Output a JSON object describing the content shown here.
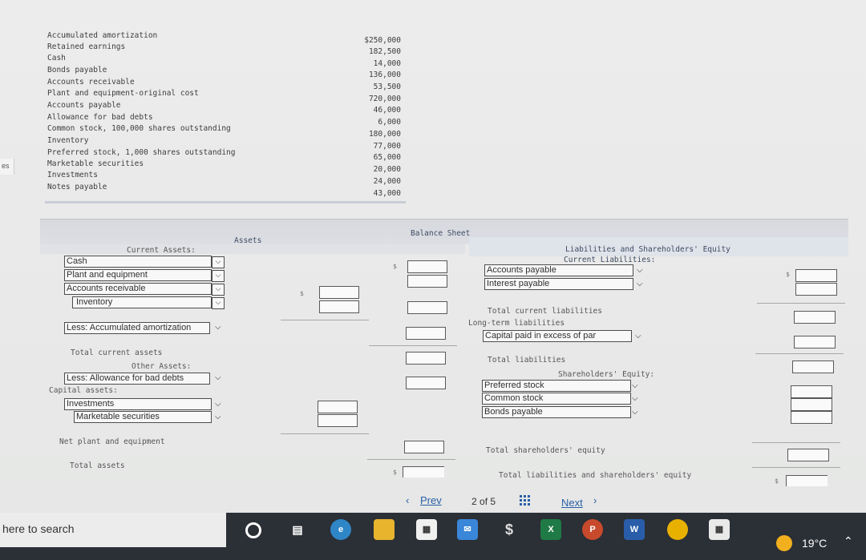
{
  "sidebar": {
    "tab_label": "es"
  },
  "data_list": [
    {
      "label": "Accumulated amortization",
      "value": "$250,000"
    },
    {
      "label": "Retained earnings",
      "value": "182,500"
    },
    {
      "label": "Cash",
      "value": "14,000"
    },
    {
      "label": "Bonds payable",
      "value": "136,000"
    },
    {
      "label": "Accounts receivable",
      "value": "53,500"
    },
    {
      "label": "Plant and equipment-original cost",
      "value": "720,000"
    },
    {
      "label": "Accounts payable",
      "value": "46,000"
    },
    {
      "label": "Allowance for bad debts",
      "value": "6,000"
    },
    {
      "label": "Common stock, 100,000 shares outstanding",
      "value": "180,000"
    },
    {
      "label": "Inventory",
      "value": "77,000"
    },
    {
      "label": "Preferred stock, 1,000 shares outstanding",
      "value": "65,000"
    },
    {
      "label": "Marketable securities",
      "value": "20,000"
    },
    {
      "label": "Investments",
      "value": "24,000"
    },
    {
      "label": "Notes payable",
      "value": "43,000"
    }
  ],
  "balance_sheet": {
    "title": "Balance Sheet",
    "assets_heading": "Assets",
    "current_assets_label": "Current Assets:",
    "liab_heading": "Liabilities and Shareholders' Equity",
    "current_liab_label": "Current Liabilities:",
    "asset_selects": [
      "Cash",
      "Plant and equipment",
      "Accounts receivable",
      "Inventory"
    ],
    "less_accum": "Less: Accumulated amortization",
    "total_current_assets": "Total current assets",
    "other_assets": "Other Assets:",
    "less_allowance": "Less: Allowance for bad debts",
    "capital_assets": "Capital assets:",
    "capital_selects": [
      "Investments",
      "Marketable securities"
    ],
    "net_plant": "Net plant and equipment",
    "total_assets": "Total assets",
    "liab_selects": [
      "Accounts payable",
      "Interest payable"
    ],
    "total_current_liab": "Total current liabilities",
    "long_term_liab": "Long-term liabilities",
    "capital_paid": "Capital paid in excess of par",
    "total_liab": "Total liabilities",
    "shareholders_equity": "Shareholders' Equity:",
    "equity_selects": [
      "Preferred stock",
      "Common stock",
      "Bonds payable"
    ],
    "total_sh_equity": "Total shareholders' equity",
    "total_liab_sh_equity": "Total liabilities and shareholders' equity",
    "dollar": "$"
  },
  "nav": {
    "prev": "Prev",
    "page_current": "2",
    "page_of": "of 5",
    "next": "Next"
  },
  "taskbar": {
    "search_text": "here to search",
    "temperature": "19°C"
  }
}
